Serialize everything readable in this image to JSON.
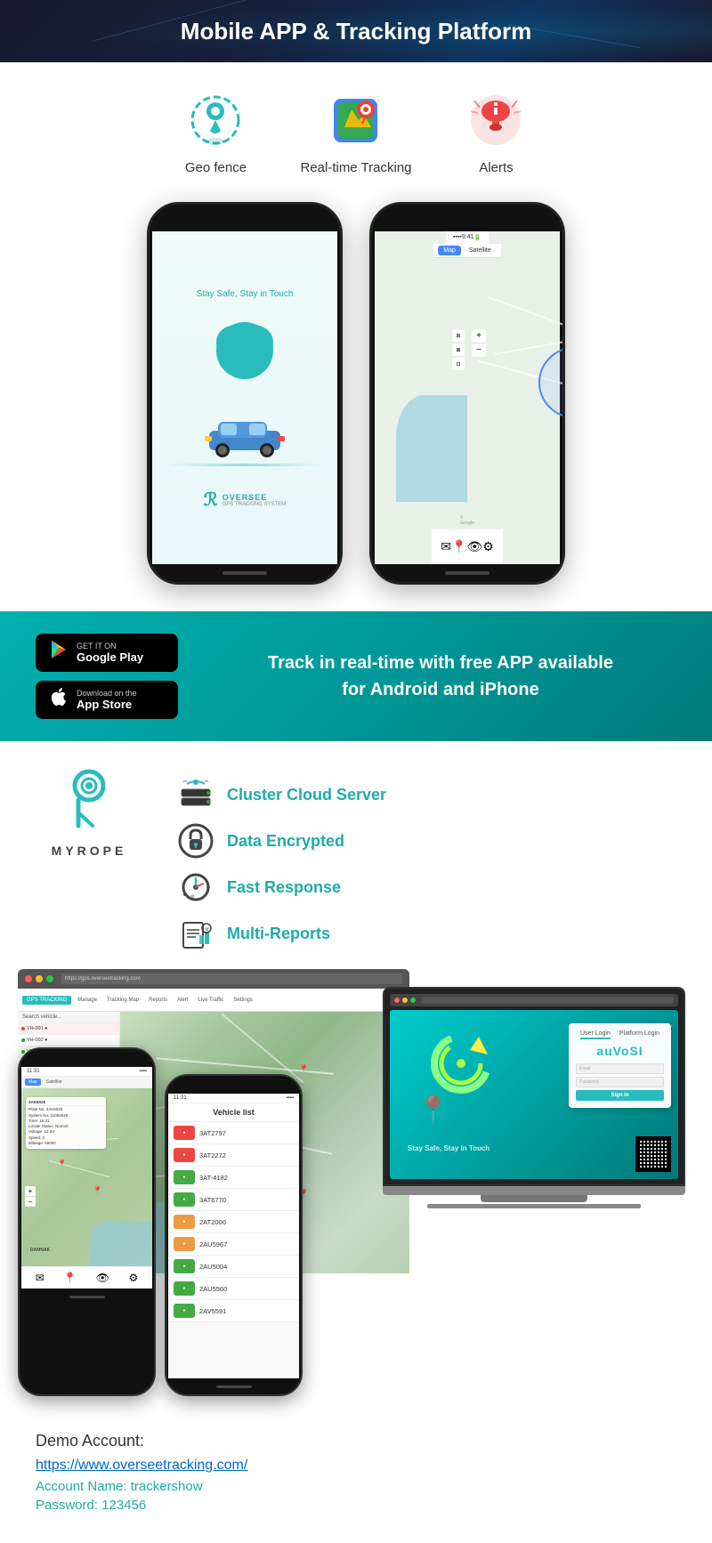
{
  "header": {
    "title": "Mobile APP & Tracking Platform"
  },
  "features": {
    "items": [
      {
        "label": "Geo fence",
        "icon": "geofence"
      },
      {
        "label": "Real-time Tracking",
        "icon": "tracking"
      },
      {
        "label": "Alerts",
        "icon": "alerts"
      }
    ]
  },
  "download": {
    "text": "Track in real-time with free APP available\n for Android and iPhone",
    "google_play": {
      "sub": "GET IT ON",
      "name": "Google Play"
    },
    "app_store": {
      "sub": "Download on the",
      "name": "App Store"
    }
  },
  "myrope": {
    "logo_text": "MYROPE",
    "server_features": [
      {
        "label": "Cluster Cloud Server",
        "icon": "cloud"
      },
      {
        "label": "Data Encrypted",
        "icon": "lock"
      },
      {
        "label": "Fast Response",
        "icon": "speed"
      },
      {
        "label": "Multi-Reports",
        "icon": "reports"
      }
    ]
  },
  "phone1": {
    "tagline": "Stay Safe, Stay in Touch",
    "logo": "OVERSEE",
    "logo_sub": "GPS TRACKING SYSTEM"
  },
  "vehicle_list": {
    "title": "Vehicle list",
    "items": [
      {
        "id": "3AT2797",
        "color": "#e44"
      },
      {
        "id": "3AT2272",
        "color": "#e44"
      },
      {
        "id": "3AT-4182",
        "color": "#4a4"
      },
      {
        "id": "3AT6770",
        "color": "#4a4"
      },
      {
        "id": "2AT2000",
        "color": "#e94"
      },
      {
        "id": "2AU5967",
        "color": "#e94"
      },
      {
        "id": "2AU5004",
        "color": "#4a4"
      },
      {
        "id": "2AU5560",
        "color": "#4a4"
      },
      {
        "id": "2AV5591",
        "color": "#4a4"
      }
    ]
  },
  "demo": {
    "title": "Demo Account:",
    "url": "https://www.overseetracking.com/",
    "account_label": "Account Name:",
    "account_value": "trackershow",
    "password_label": "Password:",
    "password_value": "123456"
  }
}
